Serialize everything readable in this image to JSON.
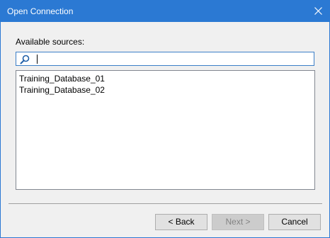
{
  "dialog": {
    "title": "Open Connection",
    "close_icon": "close-icon",
    "title_bar_color": "#2b79d3"
  },
  "sources": {
    "label": "Available sources:",
    "search": {
      "icon": "search-icon",
      "value": "",
      "placeholder": ""
    },
    "items": [
      {
        "label": "Training_Database_01"
      },
      {
        "label": "Training_Database_02"
      }
    ]
  },
  "buttons": {
    "back_label": "< Back",
    "next_label": "Next >",
    "next_enabled": false,
    "cancel_label": "Cancel"
  }
}
